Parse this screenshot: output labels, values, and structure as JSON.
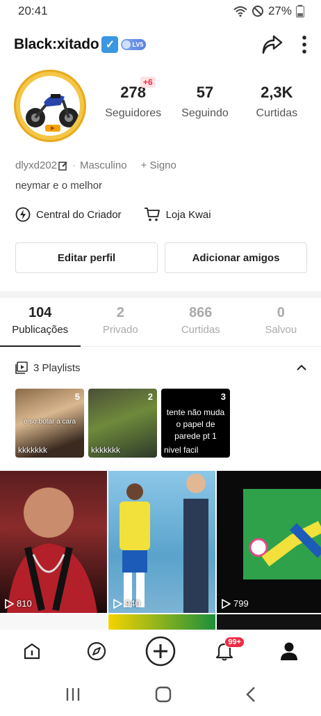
{
  "status_bar": {
    "time": "20:41",
    "battery": "27%"
  },
  "profile": {
    "username": "Black:xitado",
    "verified_mark": "✓",
    "level_badge": "LV5",
    "stats": [
      {
        "value": "278",
        "label": "Seguidores",
        "badge": "+6"
      },
      {
        "value": "57",
        "label": "Seguindo"
      },
      {
        "value": "2,3K",
        "label": "Curtidas"
      }
    ],
    "handle": "dlyxd202",
    "gender": "Masculino",
    "sign_action": "+ Signo",
    "bio": "neymar e o melhor"
  },
  "links": {
    "creator_center": "Central do Criador",
    "shop": "Loja Kwai"
  },
  "buttons": {
    "edit_profile": "Editar perfil",
    "add_friends": "Adicionar amigos"
  },
  "tabs": [
    {
      "count": "104",
      "label": "Publicações",
      "active": true
    },
    {
      "count": "2",
      "label": "Privado"
    },
    {
      "count": "866",
      "label": "Curtidas"
    },
    {
      "count": "0",
      "label": "Salvou"
    }
  ],
  "playlists": {
    "header": "3 Playlists",
    "items": [
      {
        "count": "5",
        "caption": "é so botar a cara",
        "bottom": "kkkkkkk"
      },
      {
        "count": "2",
        "caption": "",
        "bottom": "kkkkkkk"
      },
      {
        "count": "3",
        "caption": "tente não muda o papel de parede pt 1",
        "bottom": "nivel facil"
      }
    ]
  },
  "videos": [
    {
      "views": "810"
    },
    {
      "views": "940"
    },
    {
      "views": "799"
    }
  ],
  "bottom_nav": {
    "notifications_badge": "99+"
  },
  "colors": {
    "accent_red": "#ee2a44",
    "verified_blue": "#3b97e3"
  }
}
